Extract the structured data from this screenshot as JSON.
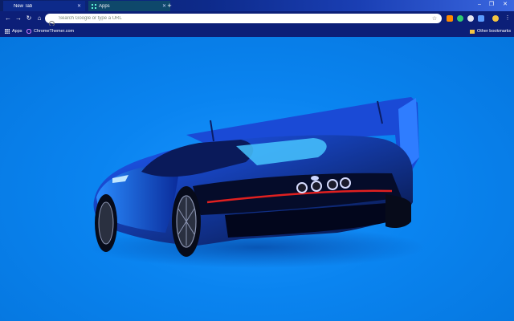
{
  "tabs": [
    {
      "title": "New Tab",
      "active": true
    },
    {
      "title": "Apps",
      "active": false
    }
  ],
  "omnibox": {
    "placeholder": "Search Google or type a URL"
  },
  "bookmarks": {
    "apps_label": "Apps",
    "items": [
      {
        "label": "ChromeThemer.com"
      }
    ],
    "other_label": "Other bookmarks"
  },
  "icons": {
    "back": "back-arrow-icon",
    "forward": "forward-arrow-icon",
    "reload": "reload-icon",
    "home": "home-icon",
    "star": "star-icon",
    "menu": "more-vert-icon"
  },
  "colors": {
    "frame": "#0c1f78",
    "background": "#0b86f2",
    "accent_stripe": "#e02020"
  }
}
